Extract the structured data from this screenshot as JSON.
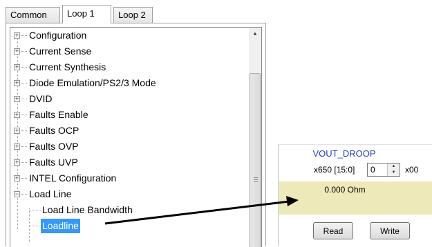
{
  "tabs": [
    {
      "label": "Common",
      "active": false
    },
    {
      "label": "Loop 1",
      "active": true
    },
    {
      "label": "Loop 2",
      "active": false
    }
  ],
  "tree": {
    "items": [
      {
        "label": "Configuration",
        "expander": "+"
      },
      {
        "label": "Current Sense",
        "expander": "+"
      },
      {
        "label": "Current Synthesis",
        "expander": "+"
      },
      {
        "label": "Diode Emulation/PS2/3 Mode",
        "expander": "+"
      },
      {
        "label": "DVID",
        "expander": "+"
      },
      {
        "label": "Faults Enable",
        "expander": "+"
      },
      {
        "label": "Faults OCP",
        "expander": "+"
      },
      {
        "label": "Faults OVP",
        "expander": "+"
      },
      {
        "label": "Faults UVP",
        "expander": "+"
      },
      {
        "label": "INTEL Configuration",
        "expander": "+"
      },
      {
        "label": "Load Line",
        "expander": "−"
      }
    ],
    "children": [
      {
        "label": "Load Line Bandwidth",
        "selected": false
      },
      {
        "label": "Loadline",
        "selected": true
      }
    ],
    "selection_color": "#3399ff"
  },
  "register": {
    "name": "VOUT_DROOP",
    "address": "x650 [15:0]",
    "input_value": "0",
    "suffix": "x00",
    "value_text": "0.000 Ohm",
    "value_bg": "#eee9b8",
    "name_color": "#1f3fc8",
    "read_label": "Read",
    "write_label": "Write"
  }
}
